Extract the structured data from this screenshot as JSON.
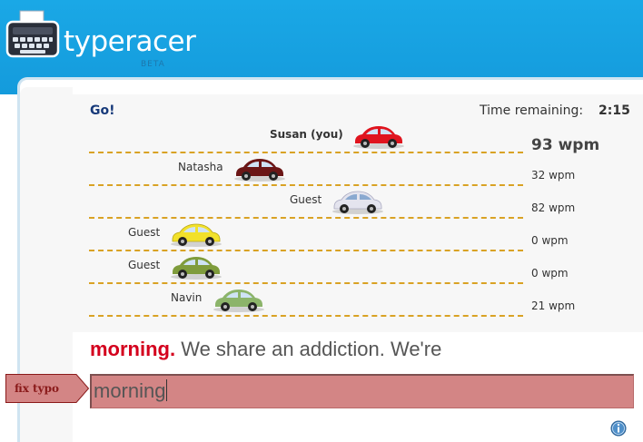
{
  "header": {
    "brand": "typeracer",
    "beta": "BETA"
  },
  "race": {
    "status": "Go!",
    "time_label": "Time remaining:",
    "time_value": "2:15",
    "racers": [
      {
        "name": "Susan (you)",
        "wpm": "93 wpm",
        "car_color": "#e0141e",
        "progress": 0.78,
        "is_you": true
      },
      {
        "name": "Natasha",
        "wpm": "32 wpm",
        "car_color": "#6b1616",
        "progress": 0.4
      },
      {
        "name": "Guest",
        "wpm": "82 wpm",
        "car_color": "#e4e4ee",
        "progress": 0.7
      },
      {
        "name": "Guest",
        "wpm": "0 wpm",
        "car_color": "#f2e12a",
        "progress": 0.25
      },
      {
        "name": "Guest",
        "wpm": "0 wpm",
        "car_color": "#7f9c3c",
        "progress": 0.25
      },
      {
        "name": "Navin",
        "wpm": "21 wpm",
        "car_color": "#8cb46a",
        "progress": 0.33
      }
    ]
  },
  "passage": {
    "typed": "morning.",
    "rest": " We share an addiction. We're"
  },
  "input": {
    "value": "morning",
    "error_label": "fix typo"
  },
  "colors": {
    "accent": "#0b86cc",
    "error_bg": "#d38585",
    "typed_text": "#d4001d",
    "track": "#d9a224"
  }
}
